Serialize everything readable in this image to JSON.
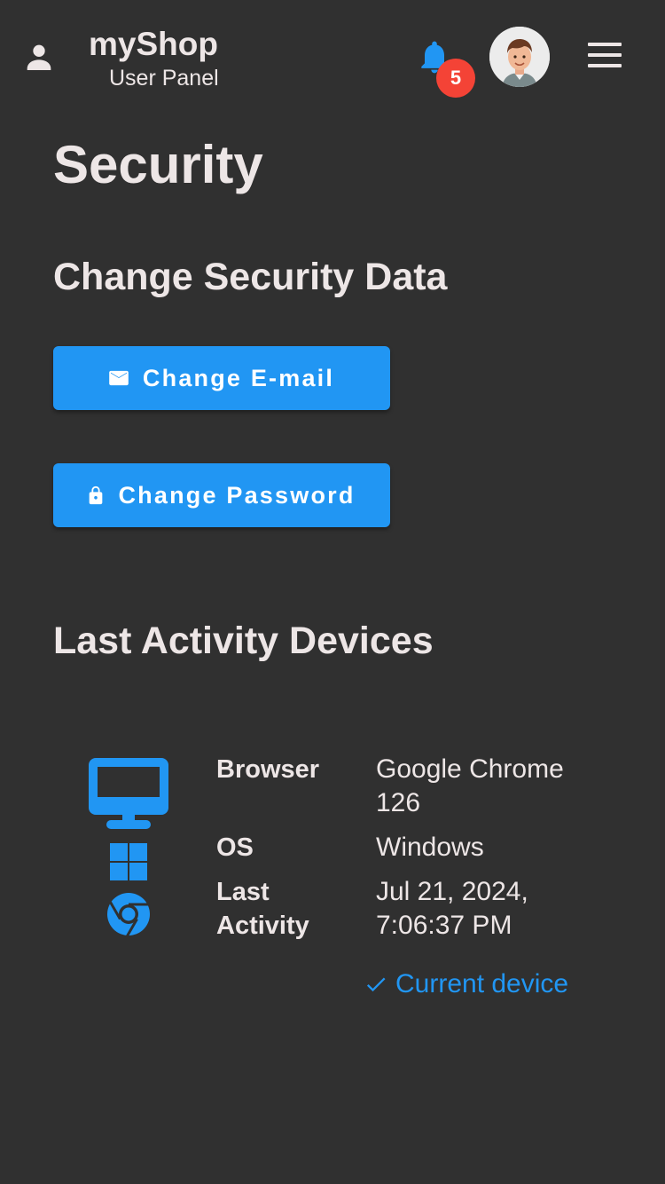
{
  "header": {
    "title": "myShop",
    "subtitle": "User Panel",
    "notification_count": "5"
  },
  "page": {
    "title": "Security"
  },
  "security": {
    "heading": "Change Security Data",
    "change_email_label": "Change E-mail",
    "change_password_label": "Change Password"
  },
  "devices": {
    "heading": "Last Activity Devices",
    "items": [
      {
        "browser_label": "Browser",
        "browser_value": "Google Chrome 126",
        "os_label": "OS",
        "os_value": "Windows",
        "activity_label": "Last Activity",
        "activity_value": "Jul 21, 2024, 7:06:37 PM",
        "current_label": "Current device",
        "icons": [
          "desktop-icon",
          "windows-icon",
          "chrome-icon"
        ]
      }
    ]
  },
  "colors": {
    "background": "#303030",
    "text": "#ede6e6",
    "accent": "#2196f3",
    "badge": "#f44336"
  },
  "icons": {
    "user": "user-icon",
    "bell": "bell-icon",
    "menu": "hamburger-menu-icon",
    "email": "envelope-icon",
    "lock": "lock-icon",
    "check": "check-icon"
  }
}
